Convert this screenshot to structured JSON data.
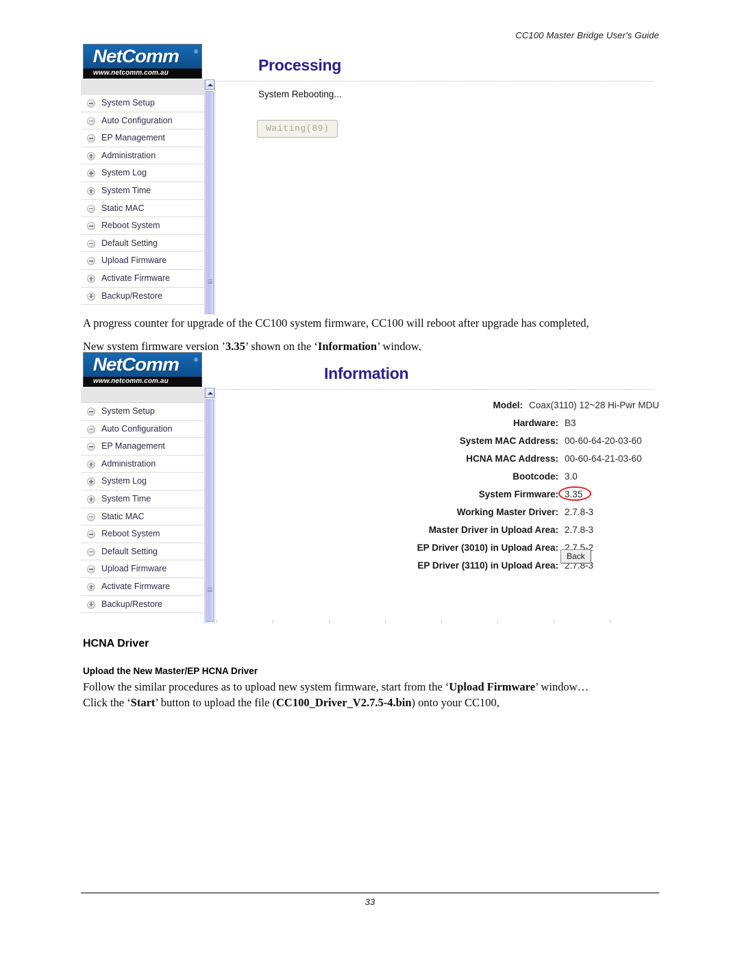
{
  "header": {
    "title": "CC100 Master Bridge User's Guide"
  },
  "footer": {
    "page_number": "33"
  },
  "brand": {
    "name": "NetComm",
    "registered_mark": "®",
    "url": "www.netcomm.com.au"
  },
  "sidebar": {
    "items": [
      {
        "label": "System Setup",
        "toggle": "minus"
      },
      {
        "label": "Auto Configuration",
        "toggle": "minus"
      },
      {
        "label": "EP Management",
        "toggle": "minus"
      },
      {
        "label": "Administration",
        "toggle": "plus"
      },
      {
        "label": "System Log",
        "toggle": "plus"
      },
      {
        "label": "System Time",
        "toggle": "plus"
      },
      {
        "label": "Static MAC",
        "toggle": "minus"
      },
      {
        "label": "Reboot System",
        "toggle": "minus"
      },
      {
        "label": "Default Setting",
        "toggle": "minus"
      },
      {
        "label": "Upload Firmware",
        "toggle": "minus"
      },
      {
        "label": "Activate Firmware",
        "toggle": "plus"
      },
      {
        "label": "Backup/Restore",
        "toggle": "plus"
      }
    ]
  },
  "processing_window": {
    "title": "Processing",
    "status_text": "System Rebooting...",
    "waiting_button": "Waiting(89)"
  },
  "information_window": {
    "title": "Information",
    "rows": [
      {
        "label": "Model:",
        "value": "Coax(3110) 12~28 Hi-Pwr MDU",
        "highlight": false
      },
      {
        "label": "Hardware:",
        "value": "B3",
        "highlight": false
      },
      {
        "label": "System MAC Address:",
        "value": "00-60-64-20-03-60",
        "highlight": false
      },
      {
        "label": "HCNA MAC Address:",
        "value": "00-60-64-21-03-60",
        "highlight": false
      },
      {
        "label": "Bootcode:",
        "value": "3.0",
        "highlight": false
      },
      {
        "label": "System Firmware:",
        "value": "3.35",
        "highlight": true
      },
      {
        "label": "Working Master Driver:",
        "value": "2.7.8-3",
        "highlight": false
      },
      {
        "label": "Master Driver in Upload Area:",
        "value": "2.7.8-3",
        "highlight": false
      },
      {
        "label": "EP Driver (3010) in Upload Area:",
        "value": "2.7.5-2",
        "highlight": false
      },
      {
        "label": "EP Driver (3110) in Upload Area:",
        "value": "2.7.8-3",
        "highlight": false
      }
    ],
    "back_button": "Back"
  },
  "body": {
    "para_1": "A progress counter for upgrade of the CC100 system firmware, CC100 will reboot after upgrade has completed,",
    "para_2_pre": "New system firmware version ’",
    "para_2_bold_1": "3.35",
    "para_2_mid": "’ shown on the ‘",
    "para_2_bold_2": "Information",
    "para_2_post": "’ window,",
    "section_heading": "HCNA Driver",
    "sub_heading": "Upload the New Master/EP HCNA Driver",
    "para_3_pre": "Follow the similar procedures as to upload new system firmware, start from the ‘",
    "para_3_bold": "Upload Firmware",
    "para_3_post": "’ window…",
    "para_4_pre": "Click the ‘",
    "para_4_bold_1": "Start",
    "para_4_mid": "’ button to upload the file (",
    "para_4_bold_2": "CC100_Driver_V2.7.5-4.bin",
    "para_4_post": ") onto your CC100,"
  },
  "colors": {
    "panel_title": "#2b1f8f",
    "logo_blue": "#105a9e",
    "highlight_ring": "#e81d1d"
  }
}
